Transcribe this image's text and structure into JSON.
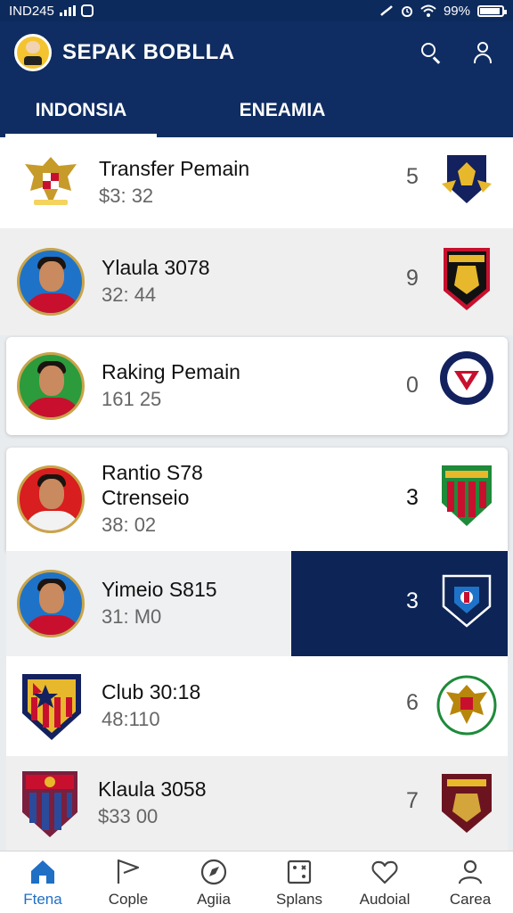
{
  "status": {
    "carrier": "IND245",
    "battery": "99%"
  },
  "app": {
    "title": "SEPAK BOBLLA"
  },
  "tabs": [
    {
      "label": "INDONSIA"
    },
    {
      "label": "ENEAMIA"
    }
  ],
  "rows": [
    {
      "title": "Transfer Pemain",
      "sub": "$3: 32",
      "num": "5"
    },
    {
      "title": "Ylaula 3078",
      "sub": "32: 44",
      "num": "9"
    },
    {
      "title": "Raking Pemain",
      "sub": "161 25",
      "num": "0"
    },
    {
      "title": "Rantio S78",
      "title2": "Ctrenseio",
      "sub": "38: 02",
      "num": "3"
    },
    {
      "title": "Yimeio S815",
      "sub": "31: M0",
      "num": "3"
    },
    {
      "title": "Club  30:18",
      "sub": "48:110",
      "num": "6"
    },
    {
      "title": "Klaula 3058",
      "sub": "$33 00",
      "num": "7"
    }
  ],
  "nav": [
    {
      "label": "Ftena"
    },
    {
      "label": "Cople"
    },
    {
      "label": "Agiia"
    },
    {
      "label": "Splans"
    },
    {
      "label": "Audoial"
    },
    {
      "label": "Carea"
    }
  ],
  "colors": {
    "navy": "#0f2d62",
    "highlight": "#0d2456",
    "active_nav": "#1f6fc5"
  }
}
